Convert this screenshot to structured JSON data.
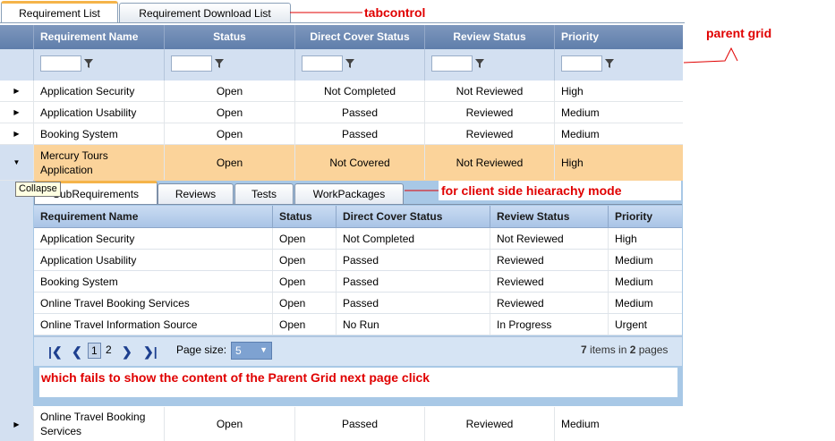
{
  "tabs": [
    "Requirement List",
    "Requirement Download List"
  ],
  "annotations": {
    "tabcontrol": "tabcontrol",
    "parent_grid": "parent grid",
    "client_side": "for client side hiearachy mode",
    "fails": "which fails to show the content of the Parent Grid next page click"
  },
  "parent_grid": {
    "columns": [
      "Requirement Name",
      "Status",
      "Direct Cover Status",
      "Review Status",
      "Priority"
    ],
    "rows": [
      {
        "name": "Application Security",
        "status": "Open",
        "direct": "Not Completed",
        "review": "Not Reviewed",
        "priority": "High"
      },
      {
        "name": "Application Usability",
        "status": "Open",
        "direct": "Passed",
        "review": "Reviewed",
        "priority": "Medium"
      },
      {
        "name": "Booking System",
        "status": "Open",
        "direct": "Passed",
        "review": "Reviewed",
        "priority": "Medium"
      },
      {
        "name": "Mercury Tours Application",
        "status": "Open",
        "direct": "Not Covered",
        "review": "Not Reviewed",
        "priority": "High"
      }
    ],
    "last_row": {
      "name": "Online Travel Booking Services",
      "status": "Open",
      "direct": "Passed",
      "review": "Reviewed",
      "priority": "Medium"
    }
  },
  "collapse_tooltip": "Collapse",
  "detail_tabs": [
    "SubRequirements",
    "Reviews",
    "Tests",
    "WorkPackages"
  ],
  "child_grid": {
    "columns": [
      "Requirement Name",
      "Status",
      "Direct Cover Status",
      "Review Status",
      "Priority"
    ],
    "rows": [
      {
        "name": "Application Security",
        "status": "Open",
        "direct": "Not Completed",
        "review": "Not Reviewed",
        "priority": "High"
      },
      {
        "name": "Application Usability",
        "status": "Open",
        "direct": "Passed",
        "review": "Reviewed",
        "priority": "Medium"
      },
      {
        "name": "Booking System",
        "status": "Open",
        "direct": "Passed",
        "review": "Reviewed",
        "priority": "Medium"
      },
      {
        "name": "Online Travel Booking Services",
        "status": "Open",
        "direct": "Passed",
        "review": "Reviewed",
        "priority": "Medium"
      },
      {
        "name": "Online Travel Information Source",
        "status": "Open",
        "direct": "No Run",
        "review": "In Progress",
        "priority": "Urgent"
      }
    ]
  },
  "pager": {
    "pages": [
      "1",
      "2"
    ],
    "page_size_label": "Page size:",
    "page_size": "5",
    "items_count": "7",
    "items_mid": " items in ",
    "pages_count": "2",
    "pages_suffix": " pages"
  },
  "colors": {
    "header": "#6f8ab4",
    "selected_row": "#fbd39a",
    "annotation": "#e00000"
  }
}
